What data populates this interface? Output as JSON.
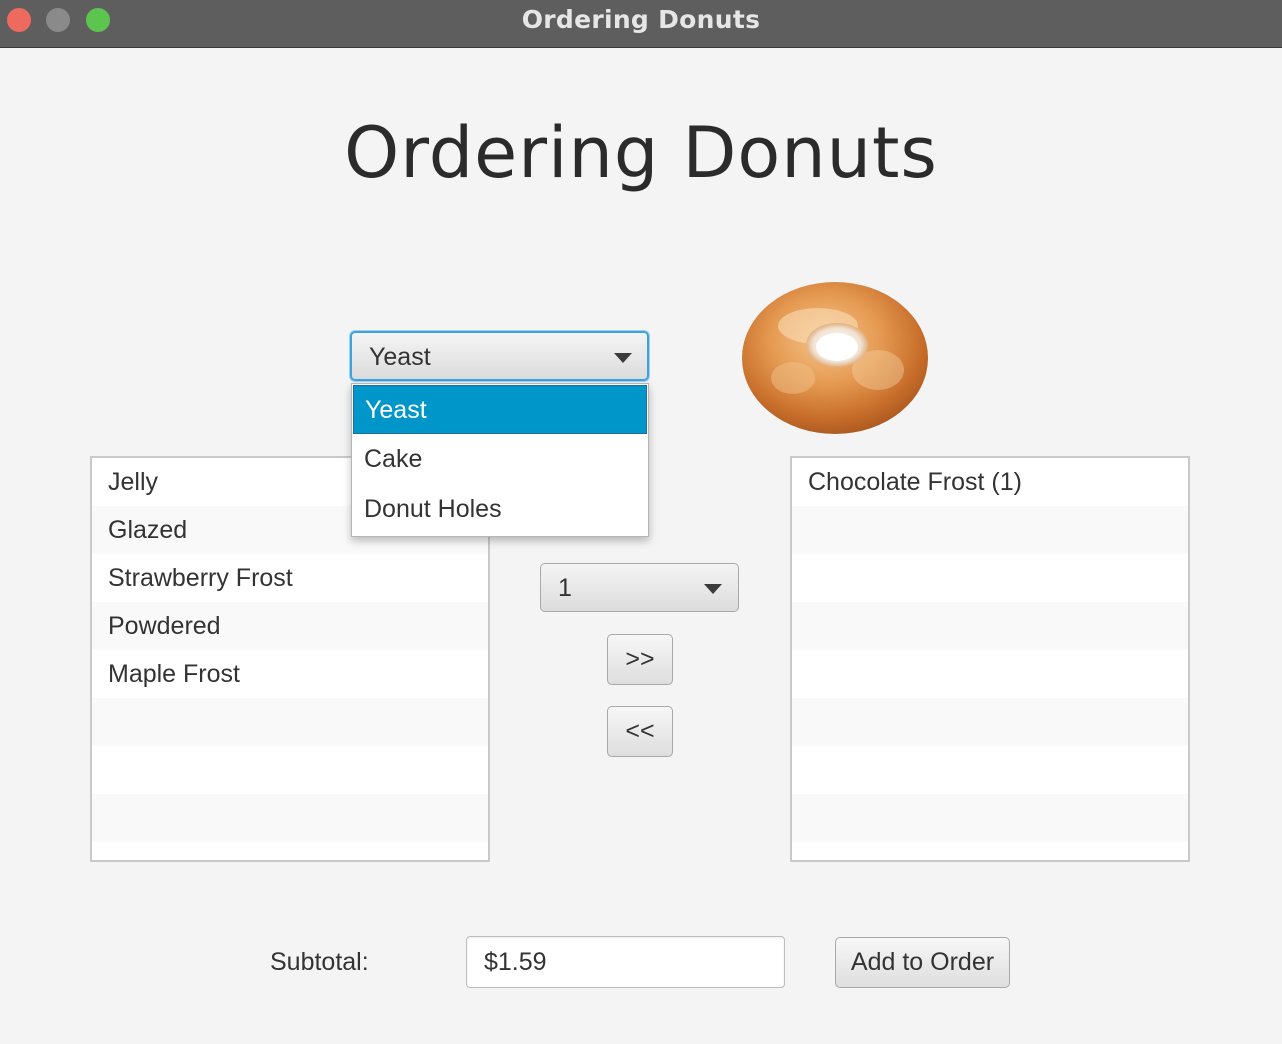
{
  "window": {
    "title": "Ordering Donuts"
  },
  "page": {
    "heading": "Ordering Donuts"
  },
  "type_selector": {
    "selected": "Yeast",
    "options": [
      "Yeast",
      "Cake",
      "Donut Holes"
    ],
    "expanded": true
  },
  "flavor_list": {
    "items": [
      "Jelly",
      "Glazed",
      "Strawberry Frost",
      "Powdered",
      "Maple Frost"
    ]
  },
  "quantity_selector": {
    "selected": "1"
  },
  "buttons": {
    "add_label": ">>",
    "remove_label": "<<",
    "add_to_order_label": "Add to Order"
  },
  "order_list": {
    "items": [
      "Chocolate Frost (1)"
    ]
  },
  "subtotal": {
    "label": "Subtotal:",
    "value": "$1.59"
  },
  "colors": {
    "selection": "#0096c9",
    "focus_border": "#3ea2e2",
    "titlebar": "#5e5e5e"
  },
  "icons": {
    "donut_image": "glazed-donut-image",
    "dropdown_arrow": "chevron-down-icon"
  }
}
